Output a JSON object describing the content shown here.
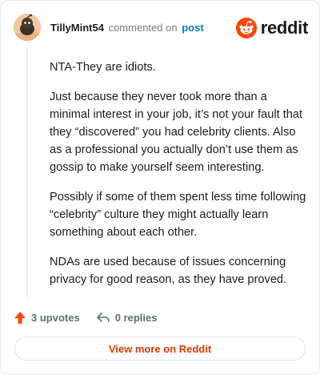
{
  "comment": {
    "username": "TillyMint54",
    "action_text": "commented on",
    "post_link": "post",
    "paragraphs": [
      "NTA-They are idiots.",
      "Just because they never took more than a minimal interest in your job, it’s not your fault that they “discovered” you had celebrity clients. Also as a professional you actually don’t use them as gossip to make yourself seem interesting.",
      "Possibly if some of them spent less time following “celebrity” culture they might actually learn something about each other.",
      "NDAs are used because of issues concerning privacy for good reason, as they have proved."
    ]
  },
  "brand": {
    "wordmark": "reddit",
    "icon": "reddit-logo-icon",
    "color": "#ff4500"
  },
  "actions": {
    "upvotes": "3 upvotes",
    "replies": "0 replies",
    "upvote_icon": "upvote-arrow-icon",
    "reply_icon": "reply-arrow-icon",
    "upvote_color": "#ff4500"
  },
  "footer": {
    "view_more": "View more on Reddit",
    "color": "#d93a00"
  }
}
